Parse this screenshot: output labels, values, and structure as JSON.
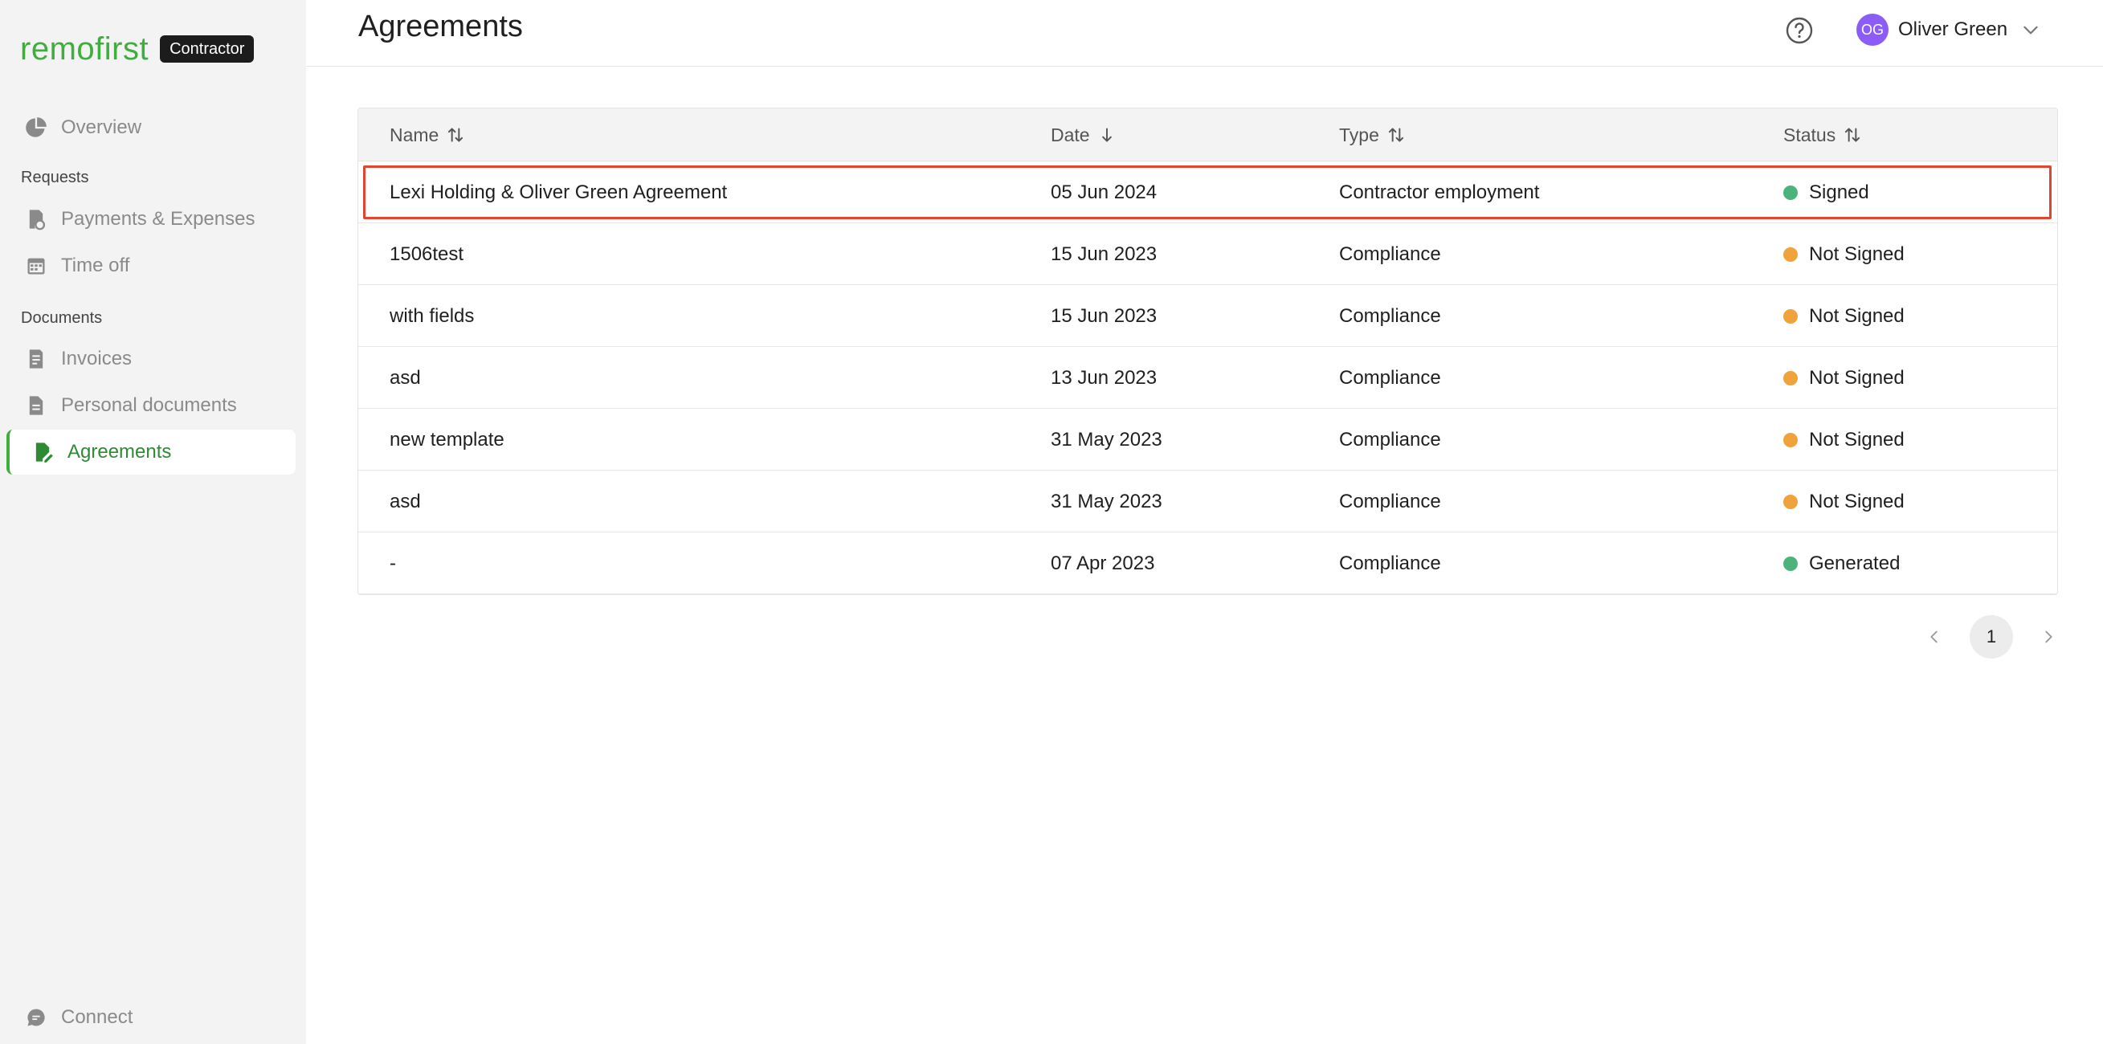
{
  "app": {
    "logo": "remofirst",
    "role_badge": "Contractor"
  },
  "sidebar": {
    "overview": "Overview",
    "section_requests": "Requests",
    "payments": "Payments & Expenses",
    "time_off": "Time off",
    "section_documents": "Documents",
    "invoices": "Invoices",
    "personal_documents": "Personal documents",
    "agreements": "Agreements",
    "connect": "Connect"
  },
  "header": {
    "title": "Agreements",
    "user_initials": "OG",
    "user_name": "Oliver Green"
  },
  "table": {
    "columns": {
      "name": "Name",
      "date": "Date",
      "type": "Type",
      "status": "Status"
    },
    "rows": [
      {
        "name": "Lexi Holding & Oliver Green Agreement",
        "date": "05 Jun 2024",
        "type": "Contractor employment",
        "status": "Signed",
        "status_color": "#4cb37b"
      },
      {
        "name": "1506test",
        "date": "15 Jun 2023",
        "type": "Compliance",
        "status": "Not Signed",
        "status_color": "#f0a23b"
      },
      {
        "name": "with fields",
        "date": "15 Jun 2023",
        "type": "Compliance",
        "status": "Not Signed",
        "status_color": "#f0a23b"
      },
      {
        "name": "asd",
        "date": "13 Jun 2023",
        "type": "Compliance",
        "status": "Not Signed",
        "status_color": "#f0a23b"
      },
      {
        "name": "new template",
        "date": "31 May 2023",
        "type": "Compliance",
        "status": "Not Signed",
        "status_color": "#f0a23b"
      },
      {
        "name": "asd",
        "date": "31 May 2023",
        "type": "Compliance",
        "status": "Not Signed",
        "status_color": "#f0a23b"
      },
      {
        "name": "-",
        "date": "07 Apr 2023",
        "type": "Compliance",
        "status": "Generated",
        "status_color": "#4cb37b"
      }
    ]
  },
  "pagination": {
    "current_page": "1"
  },
  "colors": {
    "brand": "#3fae3c",
    "highlight": "#e0452f",
    "avatar": "#8b5cf6"
  }
}
